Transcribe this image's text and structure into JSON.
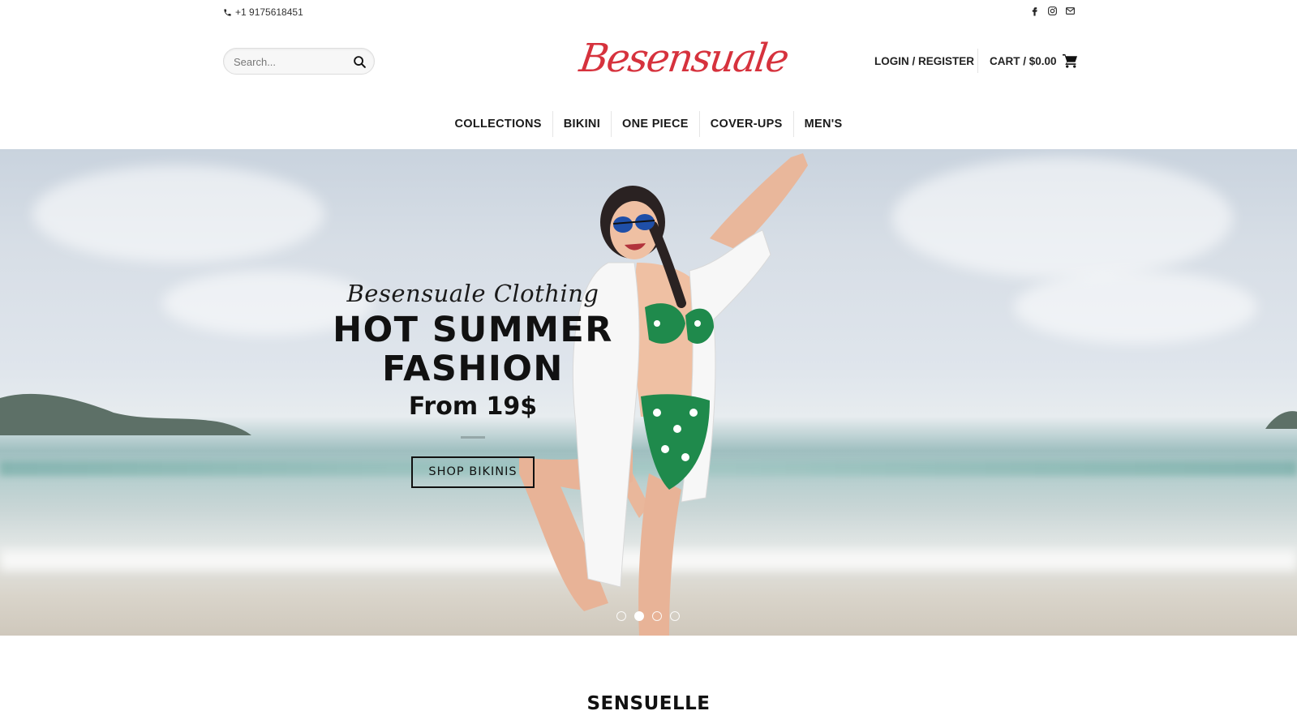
{
  "topbar": {
    "phone": "+1 9175618451",
    "socials": [
      "facebook-icon",
      "instagram-icon",
      "email-icon"
    ]
  },
  "header": {
    "search_placeholder": "Search...",
    "logo_text": "Besensuale",
    "account_label": "LOGIN / REGISTER",
    "cart_label": "CART / $0.00",
    "brand_color": "#d6323d"
  },
  "nav": {
    "items": [
      "COLLECTIONS",
      "BIKINI",
      "ONE PIECE",
      "COVER-UPS",
      "MEN'S"
    ]
  },
  "hero": {
    "script_title": "Besensuale Clothing",
    "headline_line1": "HOT SUMMER",
    "headline_line2": "FASHION",
    "subline": "From 19$",
    "button_label": "SHOP BIKINIS",
    "slides_total": 4,
    "active_slide": 2
  },
  "section": {
    "title": "SENSUELLE"
  }
}
